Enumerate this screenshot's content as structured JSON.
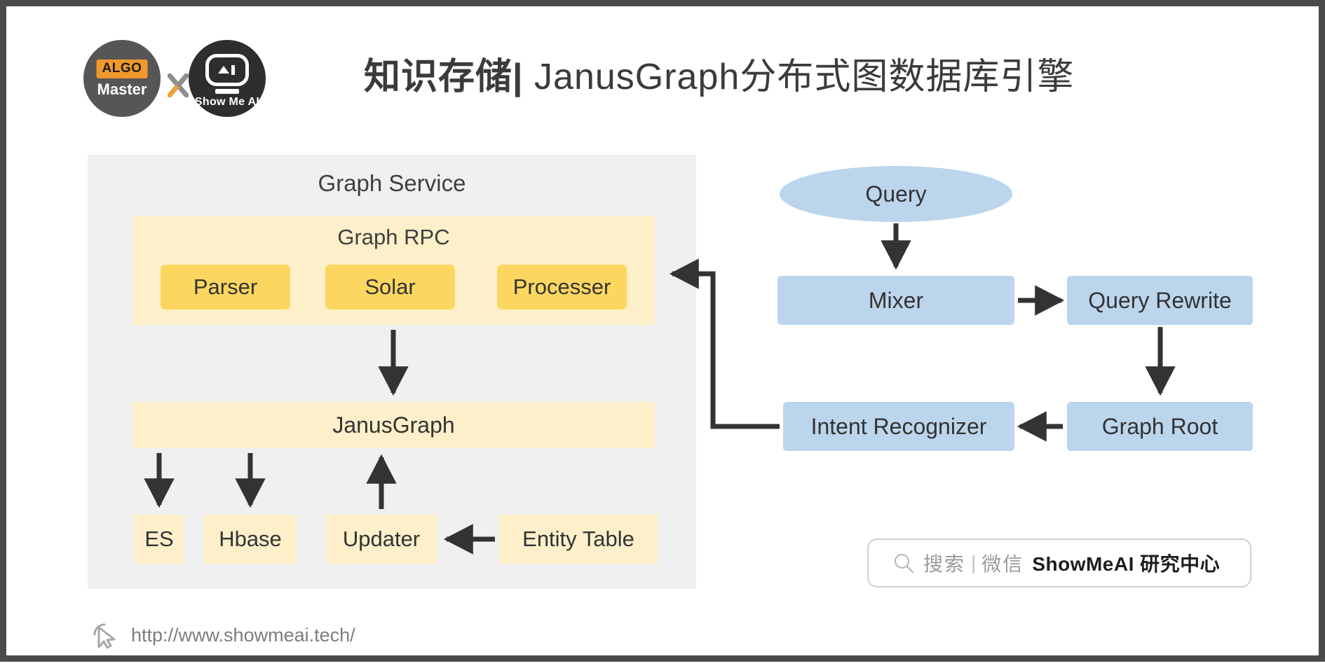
{
  "header": {
    "title_cn": "知识存储",
    "title_sep": "|",
    "title_en": "JanusGraph分布式图数据库引擎",
    "logo_left": {
      "tag": "ALGO",
      "name": "Master"
    },
    "logo_x": "X",
    "logo_right": {
      "name": "Show Me AI"
    }
  },
  "graph_service": {
    "title": "Graph Service",
    "rpc": {
      "title": "Graph RPC",
      "items": [
        {
          "label": "Parser"
        },
        {
          "label": "Solar"
        },
        {
          "label": "Processer"
        }
      ]
    },
    "janusgraph": "JanusGraph",
    "stores": [
      {
        "label": "ES"
      },
      {
        "label": "Hbase"
      },
      {
        "label": "Updater"
      },
      {
        "label": "Entity Table"
      }
    ]
  },
  "query_pipeline": {
    "query": "Query",
    "mixer": "Mixer",
    "query_rewrite": "Query Rewrite",
    "intent_recognizer": "Intent Recognizer",
    "graph_root": "Graph Root"
  },
  "footer": {
    "wechat_search": "搜索",
    "wechat_divider": "|",
    "wechat_channel": "微信",
    "wechat_brand": "ShowMeAI 研究中心",
    "url": "http://www.showmeai.tech/"
  },
  "colors": {
    "frame": "#4a4a4a",
    "panel_grey": "#F0F0F0",
    "cream": "#FDEFC9",
    "amber": "#FCD760",
    "blue": "#BBD5EC",
    "arrow": "#333333",
    "accent_orange": "#F0982B"
  }
}
